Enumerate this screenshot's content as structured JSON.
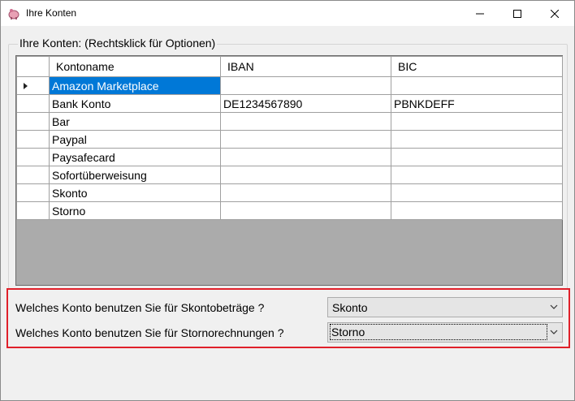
{
  "window": {
    "title": "Ihre Konten",
    "icon": "piggy-bank-icon"
  },
  "group": {
    "label": "Ihre Konten: (Rechtsklick für Optionen)"
  },
  "grid": {
    "columns": [
      "Kontoname",
      "IBAN",
      "BIC"
    ],
    "rows": [
      {
        "name": "Amazon Marketplace",
        "iban": "",
        "bic": ""
      },
      {
        "name": "Bank Konto",
        "iban": "DE1234567890",
        "bic": "PBNKDEFF"
      },
      {
        "name": "Bar",
        "iban": "",
        "bic": ""
      },
      {
        "name": "Paypal",
        "iban": "",
        "bic": ""
      },
      {
        "name": "Paysafecard",
        "iban": "",
        "bic": ""
      },
      {
        "name": "Sofortüberweisung",
        "iban": "",
        "bic": ""
      },
      {
        "name": "Skonto",
        "iban": "",
        "bic": ""
      },
      {
        "name": "Storno",
        "iban": "",
        "bic": ""
      }
    ]
  },
  "settings": {
    "skonto_label": "Welches Konto benutzen Sie für Skontobeträge ?",
    "skonto_value": "Skonto",
    "storno_label": "Welches Konto benutzen Sie für Stornorechnungen ?",
    "storno_value": "Storno"
  },
  "colors": {
    "selection": "#0078d7",
    "highlight_border": "#e0202a",
    "grid_empty": "#ababab"
  }
}
